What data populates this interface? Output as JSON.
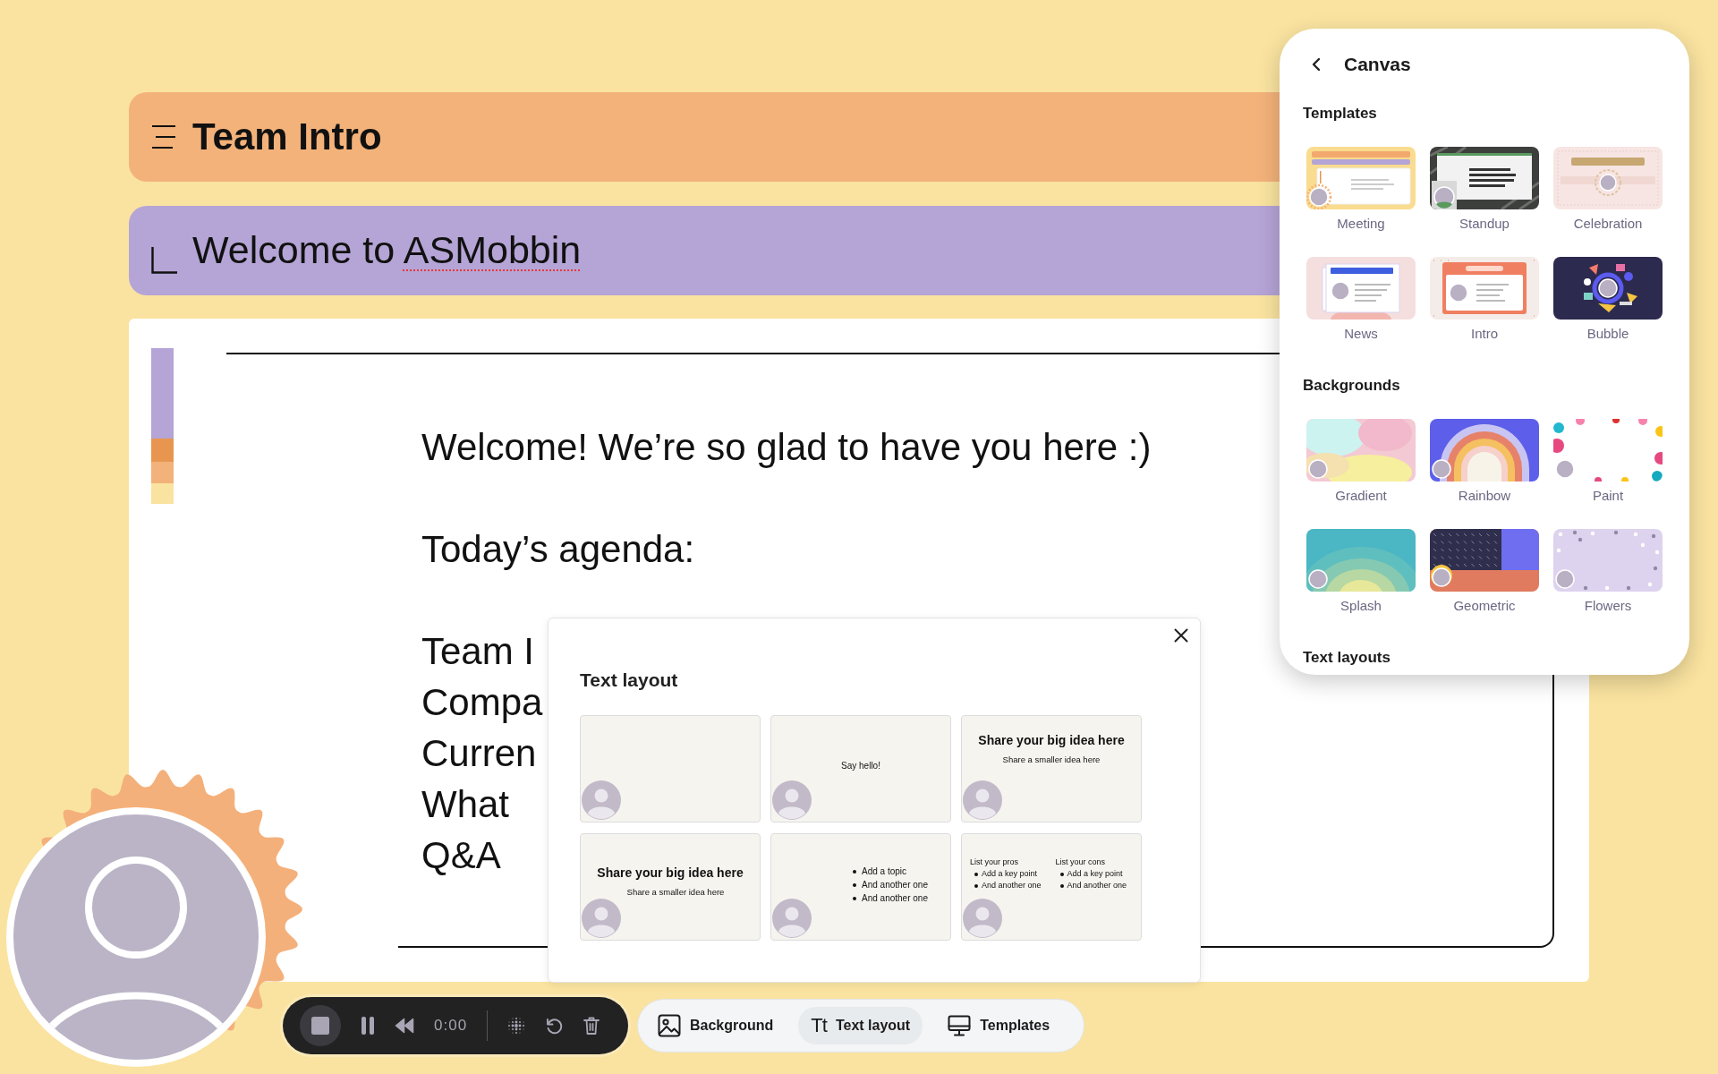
{
  "title_bar": {
    "title": "Team Intro"
  },
  "section_bar": {
    "segments": [
      {
        "text": "Welcome to ",
        "misspelled": false
      },
      {
        "text": "ASMobbin",
        "misspelled": true
      }
    ]
  },
  "slide": {
    "swatches": [
      {
        "color": "#b5a4d6"
      },
      {
        "color": "#e8964f"
      },
      {
        "color": "#f3b27a"
      },
      {
        "color": "#fae3a0"
      }
    ],
    "paragraphs": [
      {
        "lines": [
          "Welcome! We’re so glad to have you here :)"
        ]
      },
      {
        "lines": [
          "Today’s agenda:"
        ]
      },
      {
        "lines": [
          "Team I",
          "Compa",
          "Curren",
          "What",
          "Q&A"
        ]
      }
    ]
  },
  "recorder": {
    "time": "0:00"
  },
  "toolbar": {
    "items": [
      {
        "label": "Background",
        "selected": false
      },
      {
        "icon_text": "Tt",
        "label": "Text layout",
        "selected": true
      },
      {
        "label": "Templates",
        "selected": false
      }
    ]
  },
  "text_layout_dialog": {
    "title": "Text layout",
    "options": [
      {
        "kind": "blank"
      },
      {
        "kind": "caption",
        "text": "Say hello!"
      },
      {
        "kind": "title_top",
        "title": "Share your big idea here",
        "subtitle": "Share a smaller idea here"
      },
      {
        "kind": "title_middle",
        "title": "Share your big idea here",
        "subtitle": "Share a smaller idea here"
      },
      {
        "kind": "bullets",
        "bullets": [
          "Add a topic",
          "And another one",
          "And another one"
        ]
      },
      {
        "kind": "pros_cons",
        "lists": [
          {
            "heading": "List your pros",
            "bullets": [
              "Add a key point",
              "And another one"
            ]
          },
          {
            "heading": "List your cons",
            "bullets": [
              "Add a key point",
              "And another one"
            ]
          }
        ]
      }
    ]
  },
  "canvas_panel": {
    "title": "Canvas",
    "sections": [
      {
        "heading": "Templates",
        "items": [
          {
            "label": "Meeting"
          },
          {
            "label": "Standup"
          },
          {
            "label": "Celebration"
          },
          {
            "label": "News"
          },
          {
            "label": "Intro"
          },
          {
            "label": "Bubble"
          }
        ]
      },
      {
        "heading": "Backgrounds",
        "items": [
          {
            "label": "Gradient"
          },
          {
            "label": "Rainbow"
          },
          {
            "label": "Paint"
          },
          {
            "label": "Splash"
          },
          {
            "label": "Geometric"
          },
          {
            "label": "Flowers"
          }
        ]
      },
      {
        "heading": "Text layouts"
      }
    ]
  }
}
